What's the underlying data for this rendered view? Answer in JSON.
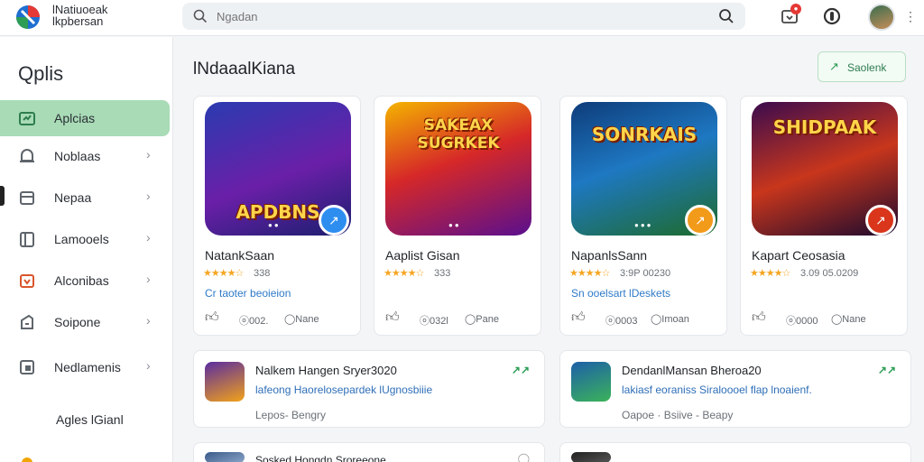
{
  "app": {
    "brand_line1": "lNatiuoeak",
    "brand_line2": "lkpbersan"
  },
  "search": {
    "placeholder": "Ngadan",
    "value": ""
  },
  "header": {
    "notification_count": "●"
  },
  "sidebar": {
    "title": "Qplis",
    "items": [
      {
        "label": "Aplcias",
        "icon": "gamepad-icon",
        "color": "#2e9d55",
        "active": true
      },
      {
        "label": "Noblaas",
        "icon": "bell-icon",
        "color": "#5f656c"
      },
      {
        "label": "Nepaa",
        "icon": "card-icon",
        "color": "#5f656c"
      },
      {
        "label": "Lamooels",
        "icon": "library-icon",
        "color": "#5f656c"
      },
      {
        "label": "Alconibas",
        "icon": "calendar-icon",
        "color": "#d9552c"
      },
      {
        "label": "Soipone",
        "icon": "wallet-icon",
        "color": "#5f656c"
      },
      {
        "label": "Nedlamenis",
        "icon": "download-icon",
        "color": "#5f656c"
      }
    ],
    "footer": "Agles lGianl"
  },
  "main": {
    "title": "lNdaaalKiana",
    "action_label": "Saolenk",
    "cards": [
      {
        "name": "NatankSaan",
        "rating": "338",
        "link": "Cr taoter beoieion",
        "stat": "ⓞ002.",
        "stat2": "◯Nane",
        "art_word": "APDBNS",
        "art_bg": "linear-gradient(160deg,#2a3bb0,#6a1fa8 55%,#1b1f6e)",
        "fab_bg": "#2d8ef0",
        "fab_icon": "↗"
      },
      {
        "name": "Aaplist Gisan",
        "rating": "333",
        "link": "",
        "stat": "ⓞ032l",
        "stat2": "◯Pane",
        "art_word": "SAKEAX SUGRKEK",
        "art_bg": "linear-gradient(160deg,#f4b400,#d62828 45%,#5a0f8e)",
        "fab_bg": "",
        "fab_icon": ""
      },
      {
        "name": "NapanlsSann",
        "rating": "3:9P 00230",
        "link": "Sn ooelsart lDeskets",
        "stat": "ⓞ0003",
        "stat2": "◯Imoan",
        "art_word": "SONRKAIS",
        "art_bg": "linear-gradient(160deg,#0e3c7a,#1e78c2 45%,#1e6b2a)",
        "fab_bg": "#f29a1a",
        "fab_icon": "↗"
      },
      {
        "name": "Kapart Ceosasia",
        "rating": "3.09 05.0209",
        "link": "",
        "stat": "ⓞ0000",
        "stat2": "◯Nane",
        "art_word": "SHIDPAAK",
        "art_bg": "linear-gradient(160deg,#3a0b4e,#c8361c 50%,#1c0a2e)",
        "fab_bg": "#d9361c",
        "fab_icon": "↗"
      }
    ],
    "rows": [
      {
        "title": "Nalkem Hangen Sryer3020",
        "desc": "lafeong Haorelosepardek lUgnosbiiie",
        "meta": "Lepos- Bengry",
        "thumb": "linear-gradient(160deg,#5a2ca0,#f2a21a)",
        "badge": "↗↗"
      },
      {
        "title": "DendanlMansan Bheroa20",
        "desc": "lakiasf eoraniss Siraloooel flap lnoaienf.",
        "meta": "Oapoe · Bsiive - Beapy",
        "thumb": "linear-gradient(160deg,#1d5fa8,#3bb35a)",
        "badge": "↗↗"
      },
      {
        "title": "Sosked Hongdn Sroreeone",
        "desc": "",
        "meta": "",
        "thumb": "linear-gradient(160deg,#3a5a88,#8aa4c8)",
        "badge": "◯"
      },
      {
        "title": "",
        "desc": "",
        "meta": "",
        "thumb": "linear-gradient(160deg,#222,#555)",
        "badge": ""
      }
    ]
  }
}
